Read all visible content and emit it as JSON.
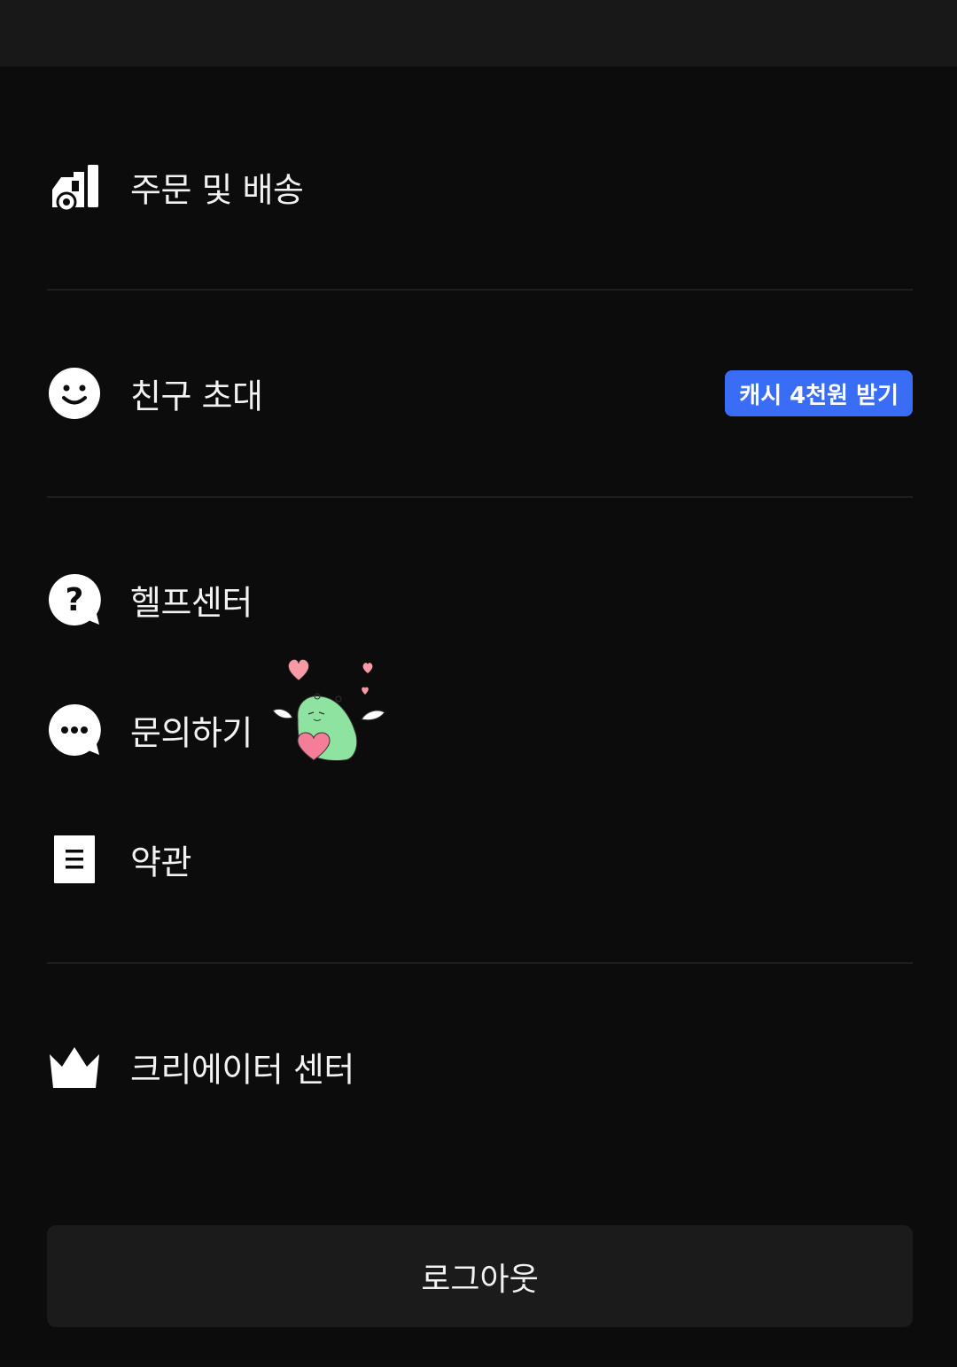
{
  "menu": {
    "orders": {
      "label": "주문 및 배송",
      "icon": "delivery-truck-icon"
    },
    "invite": {
      "label": "친구 초대",
      "icon": "smile-face-icon",
      "badge": "캐시 4천원 받기"
    },
    "help": {
      "label": "헬프센터",
      "icon": "question-bubble-icon"
    },
    "inquiry": {
      "label": "문의하기",
      "icon": "chat-bubble-icon",
      "sticker": "green-dino-heart-sticker"
    },
    "terms": {
      "label": "약관",
      "icon": "document-icon"
    },
    "creator": {
      "label": "크리에이터 센터",
      "icon": "crown-icon"
    }
  },
  "logout": {
    "label": "로그아웃"
  },
  "colors": {
    "background": "#0c0c0c",
    "topbar": "#181818",
    "badge": "#3a6df6",
    "divider": "#1e1e1e",
    "logout_button": "#1b1b1b"
  }
}
